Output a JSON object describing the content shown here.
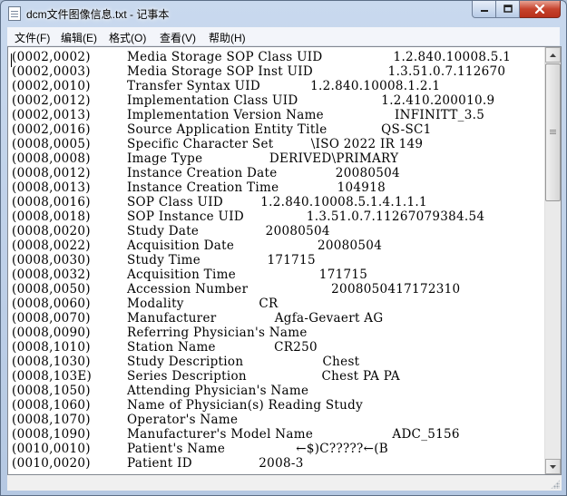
{
  "window": {
    "title": "dcm文件图像信息.txt - 记事本"
  },
  "menu": {
    "items": [
      {
        "label": "文件(F)"
      },
      {
        "label": "编辑(E)"
      },
      {
        "label": "格式(O)"
      },
      {
        "label": "查看(V)"
      },
      {
        "label": "帮助(H)"
      }
    ]
  },
  "document": {
    "lines": [
      {
        "tag": "(0002,0002)",
        "text": "Media Storage SOP Class UID                 1.2.840.10008.5.1"
      },
      {
        "tag": "(0002,0003)",
        "text": "Media Storage SOP Inst UID                  1.3.51.0.7.112670"
      },
      {
        "tag": "(0002,0010)",
        "text": "Transfer Syntax UID            1.2.840.10008.1.2.1"
      },
      {
        "tag": "(0002,0012)",
        "text": "Implementation Class UID                    1.2.410.200010.9"
      },
      {
        "tag": "(0002,0013)",
        "text": "Implementation Version Name                 INFINITT_3.5"
      },
      {
        "tag": "(0002,0016)",
        "text": "Source Application Entity Title             QS-SC1"
      },
      {
        "tag": "(0008,0005)",
        "text": "Specific Character Set         \\ISO 2022 IR 149"
      },
      {
        "tag": "(0008,0008)",
        "text": "Image Type                DERIVED\\PRIMARY"
      },
      {
        "tag": "(0008,0012)",
        "text": "Instance Creation Date              20080504"
      },
      {
        "tag": "(0008,0013)",
        "text": "Instance Creation Time              104918"
      },
      {
        "tag": "(0008,0016)",
        "text": "SOP Class UID         1.2.840.10008.5.1.4.1.1.1"
      },
      {
        "tag": "(0008,0018)",
        "text": "SOP Instance UID               1.3.51.0.7.11267079384.54"
      },
      {
        "tag": "(0008,0020)",
        "text": "Study Date                20080504"
      },
      {
        "tag": "(0008,0022)",
        "text": "Acquisition Date                    20080504"
      },
      {
        "tag": "(0008,0030)",
        "text": "Study Time                171715"
      },
      {
        "tag": "(0008,0032)",
        "text": "Acquisition Time                    171715"
      },
      {
        "tag": "(0008,0050)",
        "text": "Accession Number                    2008050417172310"
      },
      {
        "tag": "(0008,0060)",
        "text": "Modality                  CR"
      },
      {
        "tag": "(0008,0070)",
        "text": "Manufacturer              Agfa-Gevaert AG"
      },
      {
        "tag": "(0008,0090)",
        "text": "Referring Physician's Name"
      },
      {
        "tag": "(0008,1010)",
        "text": "Station Name              CR250"
      },
      {
        "tag": "(0008,1030)",
        "text": "Study Description                   Chest"
      },
      {
        "tag": "(0008,103E)",
        "text": "Series Description                  Chest PA PA"
      },
      {
        "tag": "(0008,1050)",
        "text": "Attending Physician's Name"
      },
      {
        "tag": "(0008,1060)",
        "text": "Name of Physician(s) Reading Study"
      },
      {
        "tag": "(0008,1070)",
        "text": "Operator's Name"
      },
      {
        "tag": "(0008,1090)",
        "text": "Manufacturer's Model Name                   ADC_5156"
      },
      {
        "tag": "(0010,0010)",
        "text": "Patient's Name                 ←$)C?????←(B"
      },
      {
        "tag": "(0010,0020)",
        "text": "Patient ID                2008-3"
      }
    ]
  },
  "icons": {
    "app": "notepad-icon",
    "minimize": "minimize-icon",
    "maximize": "maximize-icon",
    "close": "close-icon",
    "scroll_up": "arrow-up-icon",
    "scroll_down": "arrow-down-icon"
  },
  "colors": {
    "close_button": "#c6432d",
    "titlebar": "#c9d9ee",
    "text": "#000000"
  }
}
